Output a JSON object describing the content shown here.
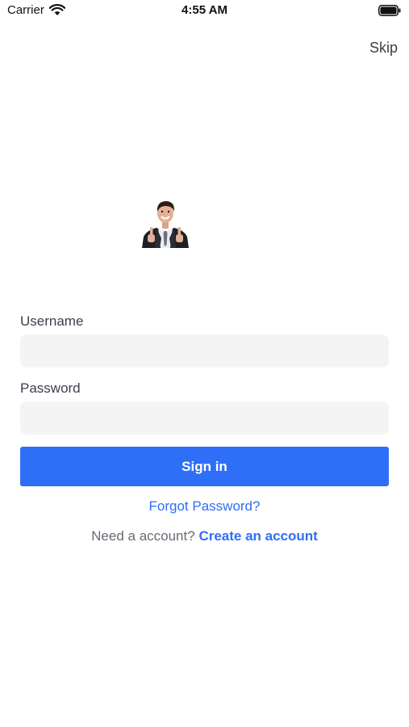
{
  "status_bar": {
    "carrier": "Carrier",
    "time": "4:55 AM",
    "wifi_icon": "wifi-icon",
    "battery_icon": "battery-icon",
    "battery_level": 1.0
  },
  "header": {
    "skip_label": "Skip"
  },
  "illustration": {
    "icon": "businessman-thumbs-up-avatar"
  },
  "form": {
    "username_label": "Username",
    "username_value": "",
    "password_label": "Password",
    "password_value": "",
    "signin_label": "Sign in",
    "forgot_label": "Forgot Password?",
    "signup_prompt": "Need a account?",
    "signup_link": "Create an account"
  },
  "colors": {
    "accent": "#2f6ef6",
    "input_background": "#f4f4f5",
    "label_text": "#3a3f4d",
    "muted_text": "#666a73"
  }
}
